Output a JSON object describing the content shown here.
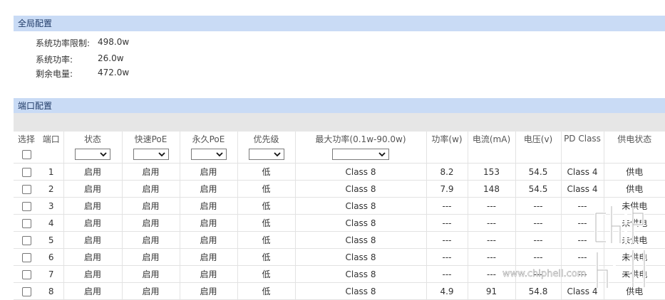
{
  "global": {
    "title": "全局配置",
    "rows": [
      {
        "label": "系统功率限制:",
        "value": "498.0w"
      },
      {
        "label": "系统功率:",
        "value": "26.0w"
      },
      {
        "label": "剩余电量:",
        "value": "472.0w"
      }
    ]
  },
  "ports_section": {
    "title": "端口配置",
    "headers": [
      "选择",
      "端口",
      "状态",
      "快速PoE",
      "永久PoE",
      "优先级",
      "最大功率(0.1w-90.0w)",
      "功率(w)",
      "电流(mA)",
      "电压(v)",
      "PD Class",
      "供电状态"
    ],
    "rows": [
      {
        "port": "1",
        "status": "启用",
        "fast_poe": "启用",
        "perm_poe": "启用",
        "priority": "低",
        "max_power": "Class 8",
        "power": "8.2",
        "current": "153",
        "voltage": "54.5",
        "pd_class": "Class 4",
        "supply": "供电"
      },
      {
        "port": "2",
        "status": "启用",
        "fast_poe": "启用",
        "perm_poe": "启用",
        "priority": "低",
        "max_power": "Class 8",
        "power": "7.9",
        "current": "148",
        "voltage": "54.5",
        "pd_class": "Class 4",
        "supply": "供电"
      },
      {
        "port": "3",
        "status": "启用",
        "fast_poe": "启用",
        "perm_poe": "启用",
        "priority": "低",
        "max_power": "Class 8",
        "power": "---",
        "current": "---",
        "voltage": "---",
        "pd_class": "---",
        "supply": "未供电"
      },
      {
        "port": "4",
        "status": "启用",
        "fast_poe": "启用",
        "perm_poe": "启用",
        "priority": "低",
        "max_power": "Class 8",
        "power": "---",
        "current": "---",
        "voltage": "---",
        "pd_class": "---",
        "supply": "未供电"
      },
      {
        "port": "5",
        "status": "启用",
        "fast_poe": "启用",
        "perm_poe": "启用",
        "priority": "低",
        "max_power": "Class 8",
        "power": "---",
        "current": "---",
        "voltage": "---",
        "pd_class": "---",
        "supply": "未供电"
      },
      {
        "port": "6",
        "status": "启用",
        "fast_poe": "启用",
        "perm_poe": "启用",
        "priority": "低",
        "max_power": "Class 8",
        "power": "---",
        "current": "---",
        "voltage": "---",
        "pd_class": "---",
        "supply": "未供电"
      },
      {
        "port": "7",
        "status": "启用",
        "fast_poe": "启用",
        "perm_poe": "启用",
        "priority": "低",
        "max_power": "Class 8",
        "power": "---",
        "current": "---",
        "voltage": "---",
        "pd_class": "---",
        "supply": "未供电"
      },
      {
        "port": "8",
        "status": "启用",
        "fast_poe": "启用",
        "perm_poe": "启用",
        "priority": "低",
        "max_power": "Class 8",
        "power": "4.9",
        "current": "91",
        "voltage": "54.8",
        "pd_class": "Class 4",
        "supply": "供电"
      }
    ]
  },
  "filters": {
    "status": "",
    "fast_poe": "",
    "perm_poe": "",
    "priority": "",
    "max_power": ""
  },
  "watermark": {
    "text": "www.chiphell.com",
    "logo": "chiphell"
  },
  "colors": {
    "header_bg": "#c9dbf5",
    "header_text": "#1f3a66",
    "band": "#e6e6e6"
  }
}
